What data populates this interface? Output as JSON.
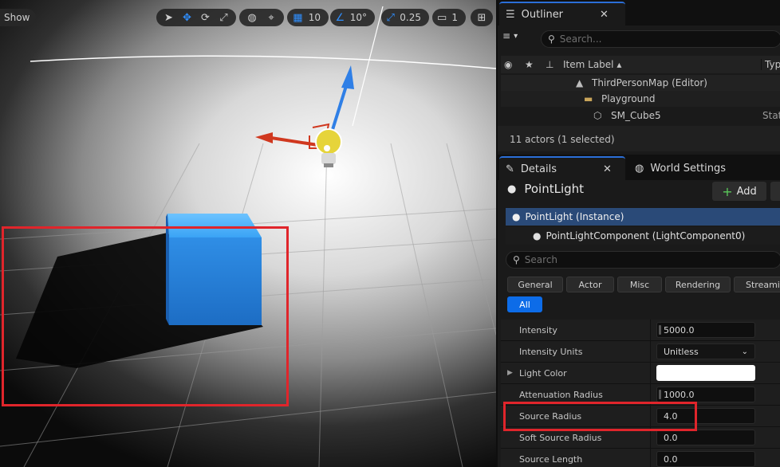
{
  "viewport": {
    "show_label": "Show",
    "grid_snap_value": "10",
    "rotation_snap_value": "10°",
    "scale_snap_value": "0.25",
    "camera_speed_value": "1"
  },
  "outliner": {
    "tab_label": "Outliner",
    "search_placeholder": "Search...",
    "columns": {
      "item_label": "Item Label",
      "type": "Type"
    },
    "rows": [
      {
        "label": "ThirdPersonMap (Editor)",
        "type": ""
      },
      {
        "label": "Playground",
        "type": ""
      },
      {
        "label": "SM_Cube5",
        "type": "Stati"
      }
    ],
    "status": "11 actors (1 selected)"
  },
  "details": {
    "tab_label": "Details",
    "world_settings_label": "World Settings",
    "actor_name": "PointLight",
    "add_label": "Add",
    "components": [
      "PointLight (Instance)",
      "PointLightComponent (LightComponent0)"
    ],
    "search_placeholder": "Search",
    "filters": [
      "General",
      "Actor",
      "Misc",
      "Rendering",
      "Streamin"
    ],
    "filter_all": "All",
    "properties": [
      {
        "label": "Intensity",
        "value": "5000.0"
      },
      {
        "label": "Intensity Units",
        "value": "Unitless"
      },
      {
        "label": "Light Color",
        "value": ""
      },
      {
        "label": "Attenuation Radius",
        "value": "1000.0"
      },
      {
        "label": "Source Radius",
        "value": "4.0"
      },
      {
        "label": "Soft Source Radius",
        "value": "0.0"
      },
      {
        "label": "Source Length",
        "value": "0.0"
      }
    ]
  },
  "colors": {
    "accent_blue": "#0d6ce8",
    "highlight_red": "#e0252b",
    "cube_blue": "#2f8ee6"
  }
}
